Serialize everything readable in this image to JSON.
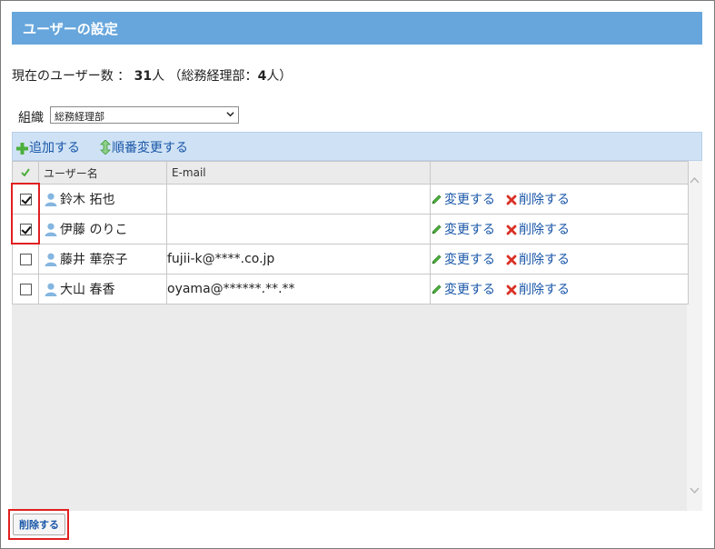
{
  "header": {
    "title": "ユーザーの設定"
  },
  "summary": {
    "prefix": "現在のユーザー数 ： ",
    "total": "31",
    "unit": "人",
    "paren_open": " （総務経理部：",
    "dept_count": "4",
    "paren_close": "人）"
  },
  "org": {
    "label": "組織",
    "selected": "総務経理部"
  },
  "toolbar": {
    "add_label": "追加する",
    "reorder_label": "順番変更する"
  },
  "table": {
    "columns": [
      "",
      "ユーザー名",
      "E-mail",
      ""
    ],
    "rows": [
      {
        "checked": true,
        "name": "鈴木 拓也",
        "email": ""
      },
      {
        "checked": true,
        "name": "伊藤 のりこ",
        "email": ""
      },
      {
        "checked": false,
        "name": "藤井 華奈子",
        "email": "fujii-k@****.co.jp"
      },
      {
        "checked": false,
        "name": "大山 春香",
        "email": "oyama@******.**.**"
      }
    ],
    "edit_label": "変更する",
    "delete_label": "削除する"
  },
  "footer": {
    "delete_button": "削除する"
  },
  "colors": {
    "title_bg": "#66a6dc",
    "toolbar_bg": "#cfe2f5",
    "link": "#1a57a8",
    "highlight": "#e02020"
  }
}
